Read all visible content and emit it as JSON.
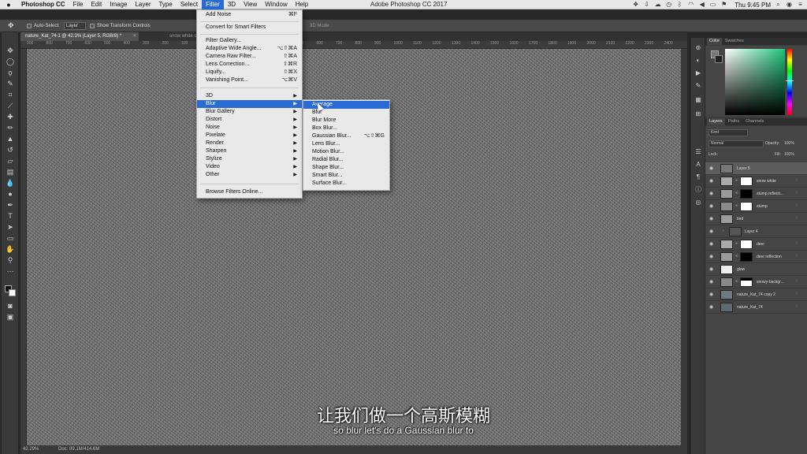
{
  "mac_menubar": {
    "app_name": "Photoshop CC",
    "menus": [
      "File",
      "Edit",
      "Image",
      "Layer",
      "Type",
      "Select",
      "Filter",
      "3D",
      "View",
      "Window",
      "Help"
    ],
    "active_menu": "Filter",
    "window_title": "Adobe Photoshop CC 2017",
    "clock": "Thu 9:45 PM"
  },
  "options_bar": {
    "auto_select_label": "Auto-Select:",
    "auto_select_value": "Layer",
    "show_transform_label": "Show Transform Controls",
    "mode_label": "3D Mode:"
  },
  "tabs": [
    {
      "label": "nature_Kat_74-1 @ 42.3% (Layer 5, RGB/8) *"
    },
    {
      "label": "snow white comp.psd"
    }
  ],
  "ruler_ticks": [
    "900",
    "800",
    "700",
    "600",
    "500",
    "400",
    "300",
    "200",
    "100",
    "0",
    "100",
    "200",
    "300",
    "400",
    "500",
    "600",
    "700",
    "800",
    "900",
    "1000",
    "1100",
    "1200",
    "1300",
    "1400",
    "1500",
    "1600",
    "1700",
    "1800",
    "1900",
    "2000",
    "2100",
    "2200",
    "2300",
    "2400"
  ],
  "status_bar": {
    "zoom": "42.29%",
    "doc": "Doc: 89.1M/414.6M"
  },
  "filter_menu": {
    "items": [
      {
        "label": "Add Noise",
        "shortcut": "⌘F"
      },
      {
        "label": "Convert for Smart Filters"
      },
      {
        "label": "Filter Gallery..."
      },
      {
        "label": "Adaptive Wide Angle...",
        "shortcut": "⌥⇧⌘A"
      },
      {
        "label": "Camera Raw Filter...",
        "shortcut": "⇧⌘A"
      },
      {
        "label": "Lens Correction...",
        "shortcut": "⇧⌘R"
      },
      {
        "label": "Liquify...",
        "shortcut": "⇧⌘X"
      },
      {
        "label": "Vanishing Point...",
        "shortcut": "⌥⌘V"
      },
      {
        "label": "3D"
      },
      {
        "label": "Blur"
      },
      {
        "label": "Blur Gallery"
      },
      {
        "label": "Distort"
      },
      {
        "label": "Noise"
      },
      {
        "label": "Pixelate"
      },
      {
        "label": "Render"
      },
      {
        "label": "Sharpen"
      },
      {
        "label": "Stylize"
      },
      {
        "label": "Video"
      },
      {
        "label": "Other"
      },
      {
        "label": "Browse Filters Online..."
      }
    ]
  },
  "blur_submenu": {
    "items": [
      {
        "label": "Average"
      },
      {
        "label": "Blur"
      },
      {
        "label": "Blur More"
      },
      {
        "label": "Box Blur..."
      },
      {
        "label": "Gaussian Blur...",
        "shortcut": "⌥⇧⌘G"
      },
      {
        "label": "Lens Blur..."
      },
      {
        "label": "Motion Blur..."
      },
      {
        "label": "Radial Blur..."
      },
      {
        "label": "Shape Blur..."
      },
      {
        "label": "Smart Blur..."
      },
      {
        "label": "Surface Blur..."
      }
    ]
  },
  "color_panel": {
    "tabs": [
      "Color",
      "Swatches"
    ],
    "field_hue": "#1ec47a"
  },
  "layers_panel": {
    "tabs": [
      "Layers",
      "Paths",
      "Channels"
    ],
    "kind_label": "Kind",
    "blend_mode": "Normal",
    "opacity_label": "Opacity:",
    "opacity_value": "100%",
    "lock_label": "Lock:",
    "fill_label": "Fill:",
    "fill_value": "100%",
    "layers": [
      {
        "name": "Layer 5"
      },
      {
        "name": "snow white"
      },
      {
        "name": "stump reflecti..."
      },
      {
        "name": "stump"
      },
      {
        "name": "bird"
      },
      {
        "name": "Layer 4"
      },
      {
        "name": "deer"
      },
      {
        "name": "deer reflection"
      },
      {
        "name": "glow"
      },
      {
        "name": "snowy-backgr..."
      },
      {
        "name": "nature_Kat_74 copy 2"
      },
      {
        "name": "nature_Kat_74"
      }
    ]
  },
  "subtitles": {
    "chinese": "让我们做一个高斯模糊",
    "english": "so blur let's do a Gaussian blur to"
  }
}
